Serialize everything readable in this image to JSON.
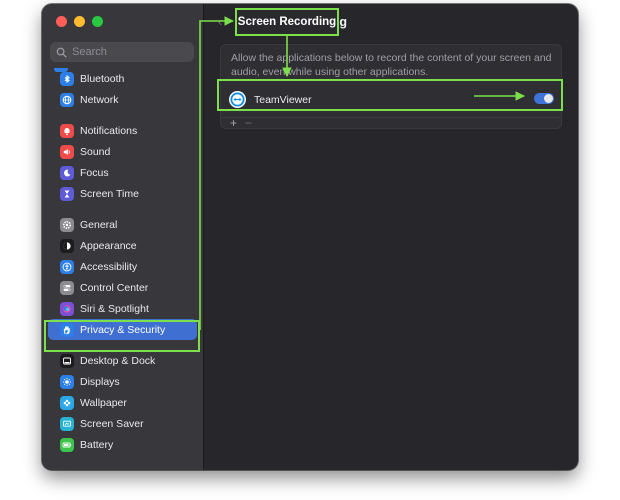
{
  "window": {
    "controls": [
      "close",
      "minimize",
      "zoom"
    ]
  },
  "sidebar": {
    "search_placeholder": "Search",
    "groups": [
      [
        {
          "label": "Bluetooth",
          "icon": "bluetooth-icon",
          "color": "#2d7fe8"
        },
        {
          "label": "Network",
          "icon": "globe-icon",
          "color": "#2d7fe8"
        }
      ],
      [
        {
          "label": "Notifications",
          "icon": "bell-icon",
          "color": "#ef4b4b"
        },
        {
          "label": "Sound",
          "icon": "speaker-icon",
          "color": "#ef4b4b"
        },
        {
          "label": "Focus",
          "icon": "moon-icon",
          "color": "#5f5ad6"
        },
        {
          "label": "Screen Time",
          "icon": "hourglass-icon",
          "color": "#5f5ad6"
        }
      ],
      [
        {
          "label": "General",
          "icon": "gear-icon",
          "color": "#8c8b90"
        },
        {
          "label": "Appearance",
          "icon": "appearance-icon",
          "color": "#1c1c1e"
        },
        {
          "label": "Accessibility",
          "icon": "accessibility-icon",
          "color": "#2d7fe8"
        },
        {
          "label": "Control Center",
          "icon": "switches-icon",
          "color": "#8c8b90"
        },
        {
          "label": "Siri & Spotlight",
          "icon": "siri-icon",
          "color": "#7b4fd6"
        },
        {
          "label": "Privacy & Security",
          "icon": "hand-icon",
          "color": "#2d7fe8",
          "active": true
        }
      ],
      [
        {
          "label": "Desktop & Dock",
          "icon": "dock-icon",
          "color": "#1c1c1e"
        },
        {
          "label": "Displays",
          "icon": "sun-icon",
          "color": "#2d7fe8"
        },
        {
          "label": "Wallpaper",
          "icon": "flower-icon",
          "color": "#2ba8e8"
        },
        {
          "label": "Screen Saver",
          "icon": "screensaver-icon",
          "color": "#26b3d6"
        },
        {
          "label": "Battery",
          "icon": "battery-icon",
          "color": "#3cc44c"
        }
      ]
    ]
  },
  "main": {
    "title": "Screen Recording",
    "description": "Allow the applications below to record the content of your screen and audio, even while using other applications.",
    "apps": [
      {
        "name": "TeamViewer",
        "enabled": true
      }
    ],
    "add_label": "+",
    "remove_label": "−"
  },
  "annotation": {
    "color": "#7ce04a"
  }
}
